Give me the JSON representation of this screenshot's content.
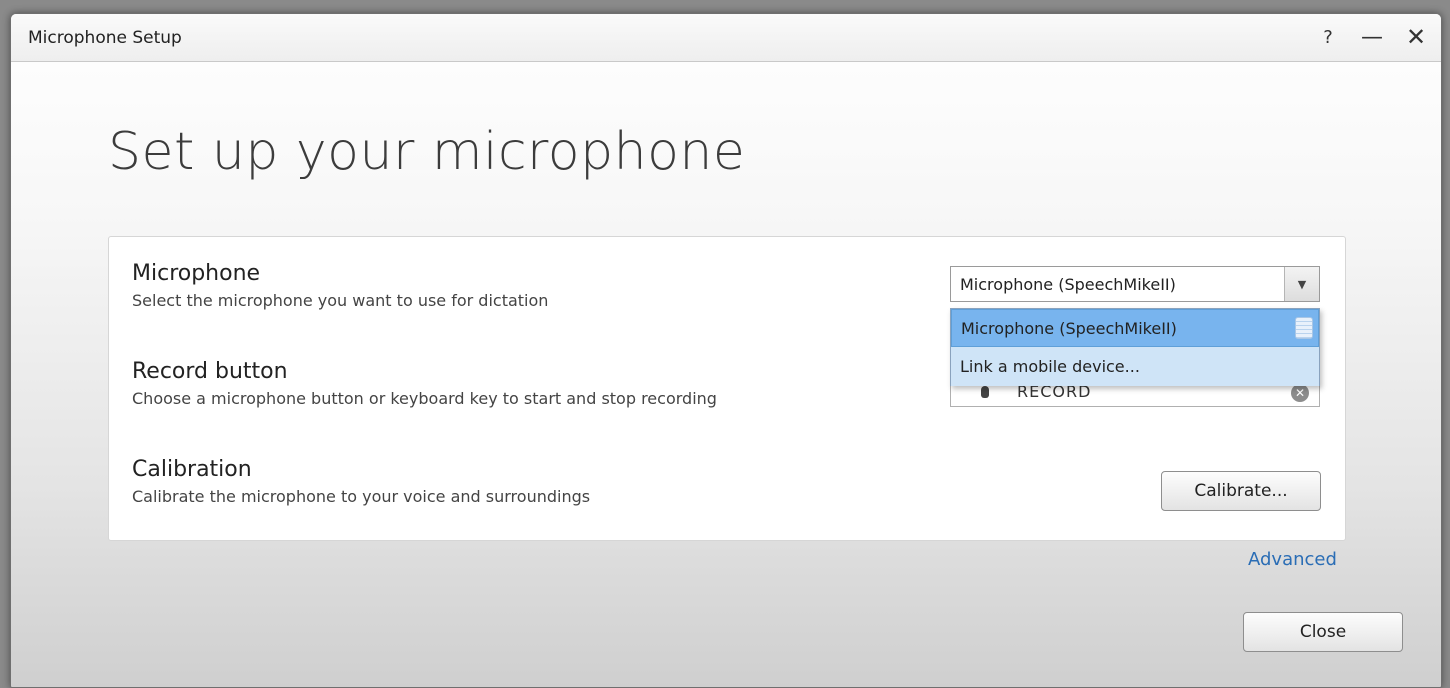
{
  "window": {
    "title": "Microphone Setup",
    "help_label": "?",
    "minimize_label": "—",
    "close_label": "✕"
  },
  "heading": "Set up your microphone",
  "microphone": {
    "title": "Microphone",
    "description": "Select the microphone you want to use for dictation",
    "selected": "Microphone (SpeechMikeII)",
    "options": [
      "Microphone (SpeechMikeII)",
      "Link a mobile device..."
    ]
  },
  "record": {
    "title": "Record button",
    "description": "Choose a microphone button or keyboard key to start and stop recording",
    "value": "RECORD",
    "clear_label": "✕"
  },
  "calibration": {
    "title": "Calibration",
    "description": "Calibrate the microphone to your voice and surroundings",
    "button_label": "Calibrate..."
  },
  "advanced_label": "Advanced",
  "close_button_label": "Close",
  "icons": {
    "dropdown": "triangle-down-icon",
    "mic": "microphone-icon",
    "scroll": "scroll-grip-icon"
  }
}
